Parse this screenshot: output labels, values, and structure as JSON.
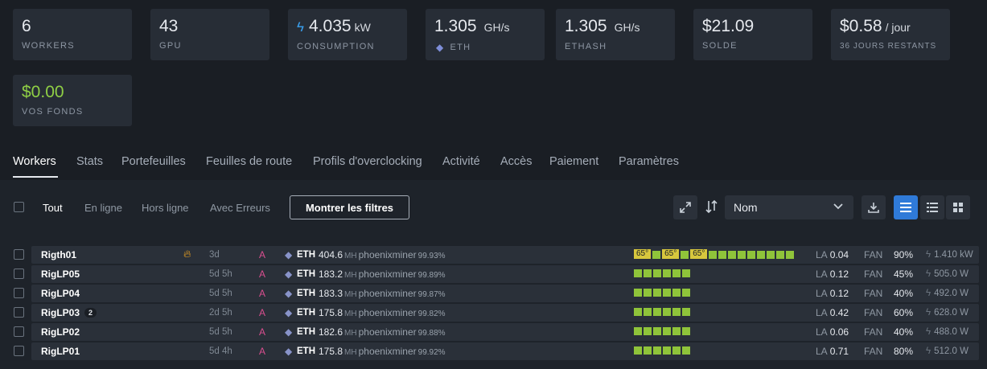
{
  "stats": [
    {
      "value": "6",
      "unit": "",
      "label": "WORKERS",
      "icon": ""
    },
    {
      "value": "43",
      "unit": "",
      "label": "GPU",
      "icon": ""
    },
    {
      "value": "4.035",
      "unit": "kW",
      "label": "CONSUMPTION",
      "icon": "lightning-icon"
    },
    {
      "value": "1.305",
      "unit": "GH/s",
      "label": "ETH",
      "icon": "ethereum-icon"
    },
    {
      "value": "1.305",
      "unit": "GH/s",
      "label": "ETHASH",
      "icon": ""
    },
    {
      "value": "$21.09",
      "unit": "",
      "label": "SOLDE",
      "icon": ""
    },
    {
      "value": "$0.58",
      "unit": "/ jour",
      "label": "36 JOURS RESTANTS",
      "icon": ""
    },
    {
      "value": "$0.00",
      "unit": "",
      "label": "VOS FONDS",
      "icon": "",
      "color": "#8fcf45"
    }
  ],
  "tabs": [
    {
      "label": "Workers",
      "active": true
    },
    {
      "label": "Stats"
    },
    {
      "label": "Portefeuilles"
    },
    {
      "label": "Feuilles de route"
    },
    {
      "label": "Profils d'overclocking"
    },
    {
      "label": "Activité"
    },
    {
      "label": "Accès"
    },
    {
      "label": "Paiement"
    },
    {
      "label": "Paramètres"
    }
  ],
  "filters": {
    "items": [
      {
        "label": "Tout",
        "active": true
      },
      {
        "label": "En ligne"
      },
      {
        "label": "Hors ligne"
      },
      {
        "label": "Avec Erreurs"
      }
    ],
    "show_filters_label": "Montrer les filtres"
  },
  "sort": {
    "selected": "Nom"
  },
  "rows": [
    {
      "name": "Rigth01",
      "badge": "",
      "flame": true,
      "uptime": "3d",
      "tag": "A",
      "algo": "ETH",
      "hashrate": "404.6",
      "hash_unit": "MH",
      "miner": "phoenixminer",
      "share": "99.93%",
      "gpus": [
        "65°",
        "sq",
        "65°",
        "sq",
        "65°",
        "sq",
        "sq",
        "sq",
        "sq",
        "sq",
        "sq",
        "sq",
        "sq",
        "sq"
      ],
      "la_label": "LA",
      "la": "0.04",
      "fan_label": "FAN",
      "fan": "90%",
      "power": "1.410",
      "power_unit": "kW"
    },
    {
      "name": "RigLP05",
      "badge": "",
      "flame": false,
      "uptime": "5d 5h",
      "tag": "A",
      "algo": "ETH",
      "hashrate": "183.2",
      "hash_unit": "MH",
      "miner": "phoenixminer",
      "share": "99.89%",
      "gpus": [
        "sq",
        "sq",
        "sq",
        "sq",
        "sq",
        "sq"
      ],
      "la_label": "LA",
      "la": "0.12",
      "fan_label": "FAN",
      "fan": "45%",
      "power": "505.0",
      "power_unit": "W"
    },
    {
      "name": "RigLP04",
      "badge": "",
      "flame": false,
      "uptime": "5d 5h",
      "tag": "A",
      "algo": "ETH",
      "hashrate": "183.3",
      "hash_unit": "MH",
      "miner": "phoenixminer",
      "share": "99.87%",
      "gpus": [
        "sq",
        "sq",
        "sq",
        "sq",
        "sq",
        "sq"
      ],
      "la_label": "LA",
      "la": "0.12",
      "fan_label": "FAN",
      "fan": "40%",
      "power": "492.0",
      "power_unit": "W"
    },
    {
      "name": "RigLP03",
      "badge": "2",
      "flame": false,
      "uptime": "2d 5h",
      "tag": "A",
      "algo": "ETH",
      "hashrate": "175.8",
      "hash_unit": "MH",
      "miner": "phoenixminer",
      "share": "99.82%",
      "gpus": [
        "sq",
        "sq",
        "sq",
        "sq",
        "sq",
        "sq"
      ],
      "la_label": "LA",
      "la": "0.42",
      "fan_label": "FAN",
      "fan": "60%",
      "power": "628.0",
      "power_unit": "W"
    },
    {
      "name": "RigLP02",
      "badge": "",
      "flame": false,
      "uptime": "5d 5h",
      "tag": "A",
      "algo": "ETH",
      "hashrate": "182.6",
      "hash_unit": "MH",
      "miner": "phoenixminer",
      "share": "99.88%",
      "gpus": [
        "sq",
        "sq",
        "sq",
        "sq",
        "sq",
        "sq"
      ],
      "la_label": "LA",
      "la": "0.06",
      "fan_label": "FAN",
      "fan": "40%",
      "power": "488.0",
      "power_unit": "W"
    },
    {
      "name": "RigLP01",
      "badge": "",
      "flame": false,
      "uptime": "5d 4h",
      "tag": "A",
      "algo": "ETH",
      "hashrate": "175.8",
      "hash_unit": "MH",
      "miner": "phoenixminer",
      "share": "99.92%",
      "gpus": [
        "sq",
        "sq",
        "sq",
        "sq",
        "sq",
        "sq"
      ],
      "la_label": "LA",
      "la": "0.71",
      "fan_label": "FAN",
      "fan": "80%",
      "power": "512.0",
      "power_unit": "W"
    }
  ],
  "colors": {
    "accent": "#2f7ad8",
    "gpu_ok": "#8fc43a",
    "gpu_temp": "#d7c73d",
    "funds": "#8fcf45",
    "tag": "#d94e8f"
  }
}
